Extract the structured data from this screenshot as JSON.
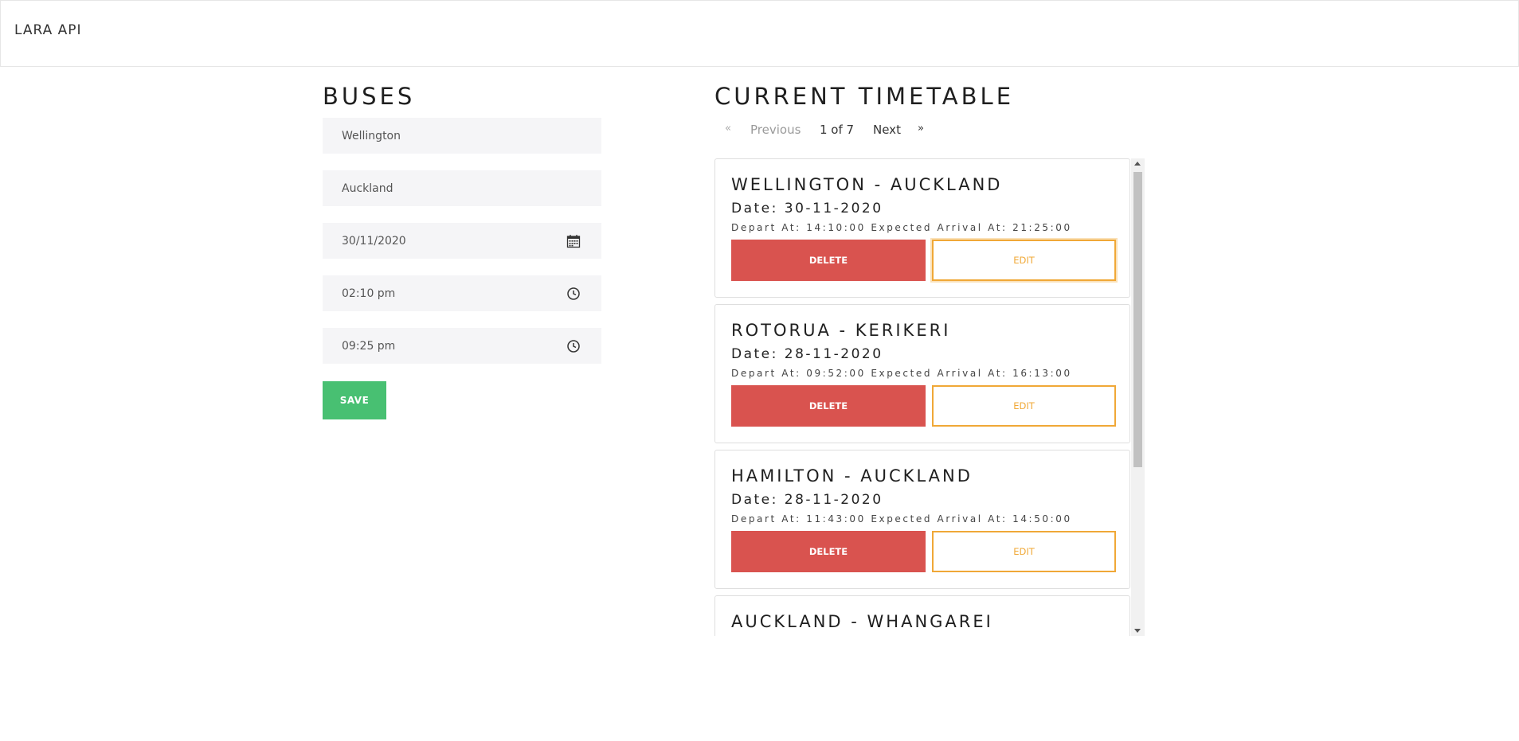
{
  "app": {
    "brand": "LARA API"
  },
  "form": {
    "title": "BUSES",
    "from_value": "Wellington",
    "to_value": "Auckland",
    "date_value": "30/11/2020",
    "depart_value": "02:10 pm",
    "arrival_value": "09:25 pm",
    "save_label": "SAVE",
    "save_color": "#48c072"
  },
  "timetable": {
    "title": "CURRENT TIMETABLE",
    "pagination": {
      "first": "«",
      "previous": "Previous",
      "info": "1 of 7",
      "next": "Next",
      "last": "»"
    },
    "trips": [
      {
        "route": "WELLINGTON - AUCKLAND",
        "date": "Date: 30-11-2020",
        "times": "Depart At: 14:10:00 Expected Arrival At: 21:25:00",
        "delete_label": "DELETE",
        "edit_label": "EDIT"
      },
      {
        "route": "ROTORUA - KERIKERI",
        "date": "Date: 28-11-2020",
        "times": "Depart At: 09:52:00 Expected Arrival At: 16:13:00",
        "delete_label": "DELETE",
        "edit_label": "EDIT"
      },
      {
        "route": "HAMILTON - AUCKLAND",
        "date": "Date: 28-11-2020",
        "times": "Depart At: 11:43:00 Expected Arrival At: 14:50:00",
        "delete_label": "DELETE",
        "edit_label": "EDIT"
      },
      {
        "route": "AUCKLAND - WHANGAREI"
      }
    ],
    "delete_color": "#d9534f",
    "edit_color": "#f0a837"
  },
  "icons": {
    "date_field": "calendar-icon",
    "time_fields": "clock-icon"
  }
}
